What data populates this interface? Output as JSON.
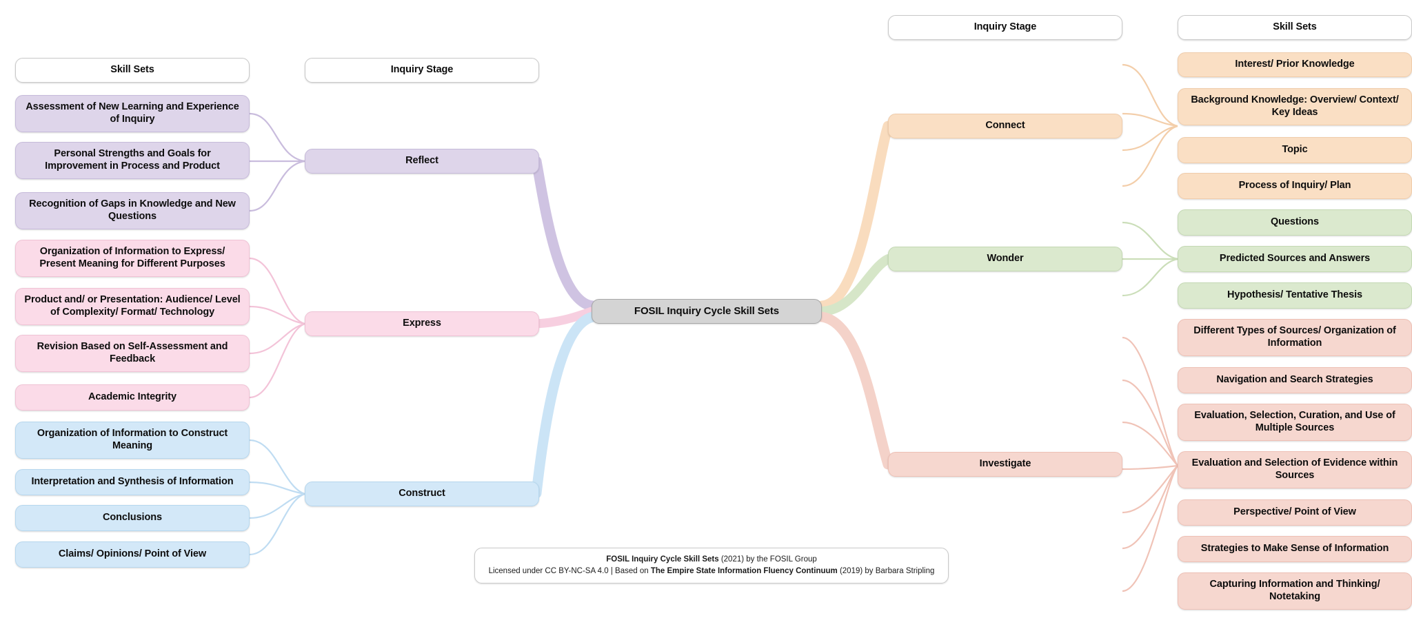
{
  "diagram": {
    "title": "FOSIL Inquiry Cycle Skill Sets",
    "center_label": "FOSIL Inquiry Cycle Skill Sets",
    "headers": {
      "left_skill_sets": "Skill Sets",
      "left_inquiry_stage": "Inquiry Stage",
      "right_inquiry_stage": "Inquiry Stage",
      "right_skill_sets": "Skill Sets"
    },
    "colors": {
      "reflect": "#ded5ea",
      "express": "#fbdbe8",
      "construct": "#d3e8f8",
      "connect": "#fadfc4",
      "wonder": "#dbe9ce",
      "investigate": "#f6d7cf",
      "center": "#d4d4d4",
      "header": "#ffffff"
    },
    "stages": {
      "reflect": {
        "label": "Reflect",
        "skills": [
          "Assessment of New Learning and Experience of Inquiry",
          "Personal Strengths and Goals for Improvement in Process and Product",
          "Recognition of Gaps in Knowledge and New Questions"
        ]
      },
      "express": {
        "label": "Express",
        "skills": [
          "Organization of Information to Express/ Present Meaning for Different Purposes",
          "Product and/ or Presentation: Audience/ Level of Complexity/ Format/ Technology",
          "Revision Based on Self-Assessment and Feedback",
          "Academic Integrity"
        ]
      },
      "construct": {
        "label": "Construct",
        "skills": [
          "Organization of Information to Construct Meaning",
          "Interpretation and Synthesis of Information",
          "Conclusions",
          "Claims/ Opinions/ Point of View"
        ]
      },
      "connect": {
        "label": "Connect",
        "skills": [
          "Interest/ Prior Knowledge",
          "Background Knowledge: Overview/ Context/ Key Ideas",
          "Topic",
          "Process of Inquiry/ Plan"
        ]
      },
      "wonder": {
        "label": "Wonder",
        "skills": [
          "Questions",
          "Predicted Sources and Answers",
          "Hypothesis/ Tentative Thesis"
        ]
      },
      "investigate": {
        "label": "Investigate",
        "skills": [
          "Different Types of Sources/ Organization of Information",
          "Navigation and Search Strategies",
          "Evaluation, Selection, Curation, and Use of Multiple Sources",
          "Evaluation and Selection of Evidence within Sources",
          "Perspective/ Point of View",
          "Strategies to Make Sense of Information",
          "Capturing Information and Thinking/ Notetaking"
        ]
      }
    },
    "credit": {
      "line1_bold": "FOSIL Inquiry Cycle Skill Sets",
      "line1_rest": " (2021) by the FOSIL Group",
      "line2_a": "Licensed under CC BY-NC-SA 4.0 | Based on ",
      "line2_bold": "The Empire State Information Fluency Continuum",
      "line2_b": " (2019) by Barbara Stripling"
    }
  }
}
